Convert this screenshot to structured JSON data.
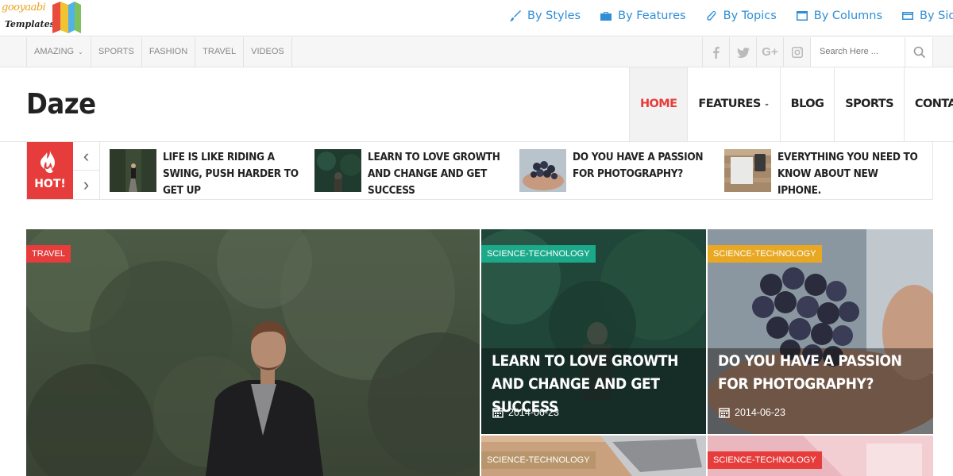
{
  "topbar": {
    "logo_line1": "gooyaabi",
    "logo_line2": "Templates",
    "links": [
      {
        "label": "By Styles",
        "icon": "brush-icon"
      },
      {
        "label": "By Features",
        "icon": "briefcase-icon"
      },
      {
        "label": "By Topics",
        "icon": "paperclip-icon"
      },
      {
        "label": "By Columns",
        "icon": "window-icon"
      },
      {
        "label": "By Sideb",
        "icon": "card-icon"
      }
    ]
  },
  "subbar": {
    "categories": [
      "AMAZING",
      "SPORTS",
      "FASHION",
      "TRAVEL",
      "VIDEOS"
    ],
    "social": [
      "facebook-icon",
      "twitter-icon",
      "google-plus-icon",
      "instagram-icon"
    ],
    "google_plus_label": "G+",
    "search_placeholder": "Search Here ..."
  },
  "header": {
    "brand": "Daze",
    "nav": [
      {
        "label": "HOME",
        "active": true
      },
      {
        "label": "FEATURES",
        "active": false
      },
      {
        "label": "BLOG",
        "active": false
      },
      {
        "label": "SPORTS",
        "active": false
      },
      {
        "label": "CONTACT",
        "active": false
      }
    ]
  },
  "ticker": {
    "hot_label": "HOT!",
    "items": [
      {
        "title": "LIFE IS LIKE RIDING A SWING, PUSH HARDER TO GET UP"
      },
      {
        "title": "LEARN TO LOVE GROWTH AND CHANGE AND GET SUCCESS"
      },
      {
        "title": "DO YOU HAVE A PASSION FOR PHOTOGRAPHY?"
      },
      {
        "title": "EVERYTHING YOU NEED TO KNOW ABOUT NEW IPHONE."
      }
    ]
  },
  "featured": {
    "main": {
      "category": "TRAVEL",
      "category_color": "#e63c3c"
    },
    "cards": [
      {
        "category": "SCIENCE-TECHNOLOGY",
        "category_color": "#1aaa8a",
        "title": "LEARN TO LOVE GROWTH AND CHANGE AND GET SUCCESS",
        "date": "2014-06-23"
      },
      {
        "category": "SCIENCE-TECHNOLOGY",
        "category_color": "#e8a823",
        "title": "DO YOU HAVE A PASSION FOR PHOTOGRAPHY?",
        "date": "2014-06-23"
      },
      {
        "category": "SCIENCE-TECHNOLOGY",
        "category_color": "#b8956a"
      },
      {
        "category": "SCIENCE-TECHNOLOGY",
        "category_color": "#e63c3c"
      }
    ]
  }
}
